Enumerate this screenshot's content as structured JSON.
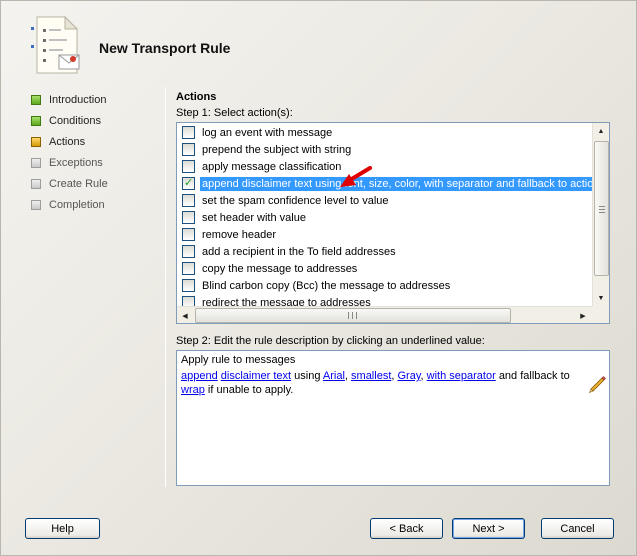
{
  "dialog": {
    "title": "New Transport Rule"
  },
  "wizard_steps": [
    {
      "label": "Introduction",
      "state": "done"
    },
    {
      "label": "Conditions",
      "state": "done"
    },
    {
      "label": "Actions",
      "state": "current"
    },
    {
      "label": "Exceptions",
      "state": "pending"
    },
    {
      "label": "Create Rule",
      "state": "pending"
    },
    {
      "label": "Completion",
      "state": "pending"
    }
  ],
  "actions": {
    "section_title": "Actions",
    "step1_label": "Step 1: Select action(s):",
    "items": [
      {
        "label": "log an event with message",
        "checked": false,
        "selected": false
      },
      {
        "label": "prepend the subject with string",
        "checked": false,
        "selected": false
      },
      {
        "label": "apply message classification",
        "checked": false,
        "selected": false
      },
      {
        "label": "append disclaimer text using font, size, color, with separator and fallback to action if",
        "checked": true,
        "selected": true
      },
      {
        "label": "set the spam confidence level to value",
        "checked": false,
        "selected": false
      },
      {
        "label": "set header with value",
        "checked": false,
        "selected": false
      },
      {
        "label": "remove header",
        "checked": false,
        "selected": false
      },
      {
        "label": "add a recipient in the To field addresses",
        "checked": false,
        "selected": false
      },
      {
        "label": "copy the message to addresses",
        "checked": false,
        "selected": false
      },
      {
        "label": "Blind carbon copy (Bcc) the message to addresses",
        "checked": false,
        "selected": false
      },
      {
        "label": "redirect the message to addresses",
        "checked": false,
        "selected": false
      }
    ],
    "step2_label": "Step 2: Edit the rule description by clicking an underlined value:",
    "description": {
      "line1": "Apply rule to messages",
      "append": "append",
      "disclaimer_text": "disclaimer text",
      "using": "using",
      "font": "Arial",
      "size": "smallest",
      "color": "Gray",
      "separator": "with separator",
      "and_fallback_to": "and fallback to",
      "fallback": "wrap",
      "if_unable": "if unable to apply.",
      "comma": ","
    }
  },
  "buttons": {
    "help": "Help",
    "back": "< Back",
    "next": "Next >",
    "cancel": "Cancel"
  },
  "colors": {
    "selection": "#3399ff",
    "link": "#0000ee",
    "arrow": "#e00000"
  }
}
